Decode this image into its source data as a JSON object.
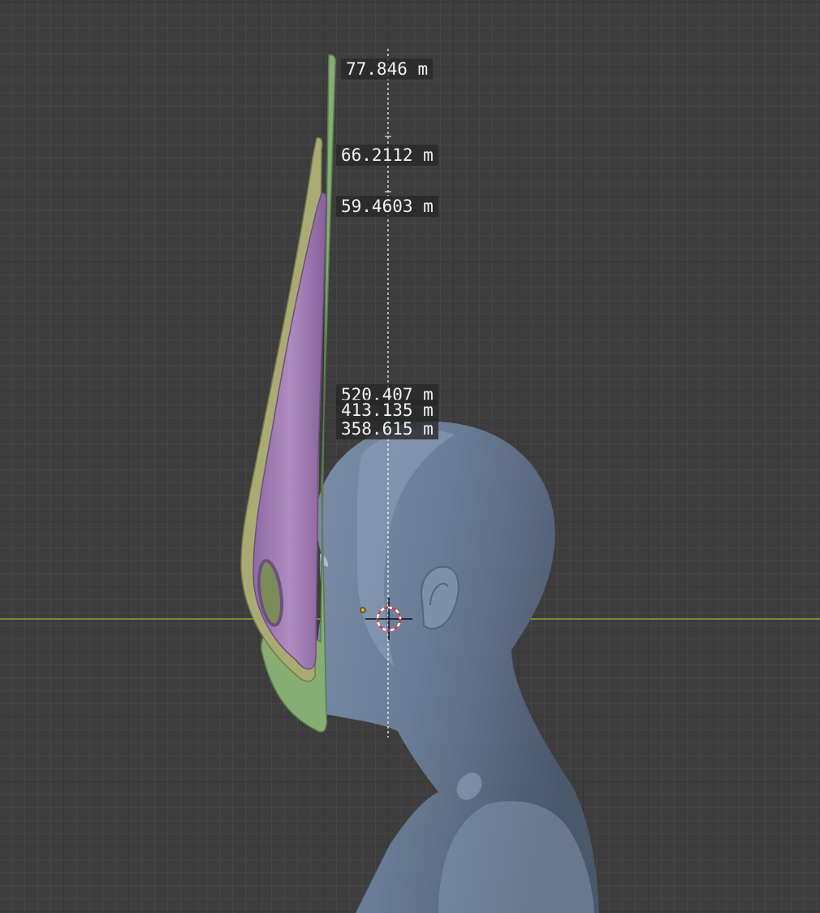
{
  "viewport": {
    "background": "#3d3d3d",
    "x_axis_color": "#7b8a3a",
    "measure_line_color": "#ffffff"
  },
  "measurements": [
    {
      "label": "77.846 m",
      "color": "#8fb87e"
    },
    {
      "label": "66.2112 m",
      "color": "#b3b47c"
    },
    {
      "label": "59.4603 m",
      "color": "#9c79b0"
    },
    {
      "label": "520.407 m"
    },
    {
      "label": "413.135 m"
    },
    {
      "label": "358.615 m"
    }
  ],
  "objects": {
    "head": {
      "color": "#6f8199"
    },
    "mask_green": {
      "color": "#86ad74"
    },
    "mask_yellow": {
      "color": "#a9ab72"
    },
    "mask_purple": {
      "color": "#9a77ad"
    }
  },
  "icons": [
    "3d-cursor-icon",
    "origin-dot-icon"
  ]
}
